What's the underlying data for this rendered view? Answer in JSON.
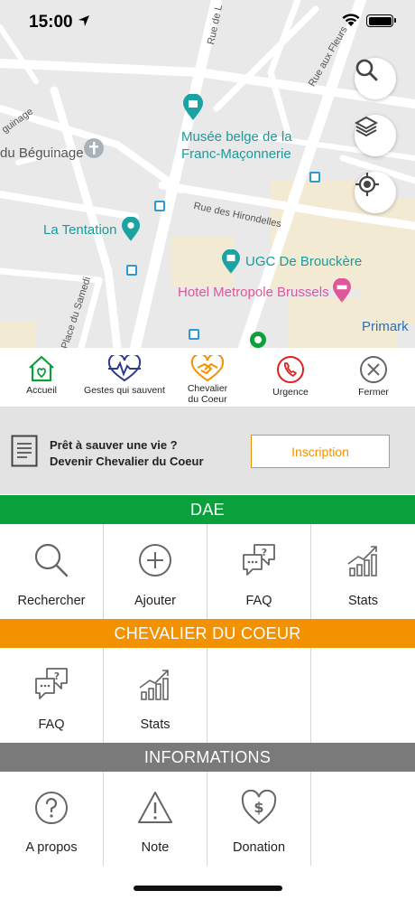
{
  "status_bar": {
    "time": "15:00"
  },
  "map": {
    "labels": {
      "musee": "Musée belge de la",
      "musee2": "Franc-Maçonnerie",
      "beguinage": "du Béguinage",
      "tentation": "La Tentation",
      "ugc": "UGC De Brouckère",
      "metropole": "Hotel Metropole Brussels",
      "primark": "Primark",
      "rue_hirondelles": "Rue des Hirondelles",
      "rue_fleurs": "Rue aux Fleurs",
      "rue_l": "Rue de L",
      "place_samedi": "Place du Samedi",
      "guinage": "guinage"
    },
    "colors": {
      "poi_teal": "#1aa3a3",
      "poi_pink": "#e0569a",
      "poi_blue": "#2b6fb5"
    }
  },
  "nav": {
    "items": [
      {
        "label": "Accueil"
      },
      {
        "label": "Gestes qui sauvent"
      },
      {
        "label": "Chevalier\ndu Coeur"
      },
      {
        "label": "Urgence"
      },
      {
        "label": "Fermer"
      }
    ]
  },
  "promo": {
    "line1": "Prêt à sauver une vie ?",
    "line2": "Devenir Chevalier du Coeur",
    "button": "Inscription"
  },
  "sections": {
    "dae": {
      "title": "DAE",
      "color": "#0aa03c",
      "items": [
        {
          "label": "Rechercher",
          "icon": "search-icon"
        },
        {
          "label": "Ajouter",
          "icon": "plus-circle-icon"
        },
        {
          "label": "FAQ",
          "icon": "faq-icon"
        },
        {
          "label": "Stats",
          "icon": "stats-icon"
        }
      ]
    },
    "chevalier": {
      "title": "CHEVALIER DU COEUR",
      "color": "#f39200",
      "items": [
        {
          "label": "FAQ",
          "icon": "faq-icon"
        },
        {
          "label": "Stats",
          "icon": "stats-icon"
        }
      ]
    },
    "informations": {
      "title": "INFORMATIONS",
      "color": "#7a7a7a",
      "items": [
        {
          "label": "A propos",
          "icon": "question-circle-icon"
        },
        {
          "label": "Note",
          "icon": "warning-icon"
        },
        {
          "label": "Donation",
          "icon": "heart-dollar-icon"
        }
      ]
    }
  }
}
